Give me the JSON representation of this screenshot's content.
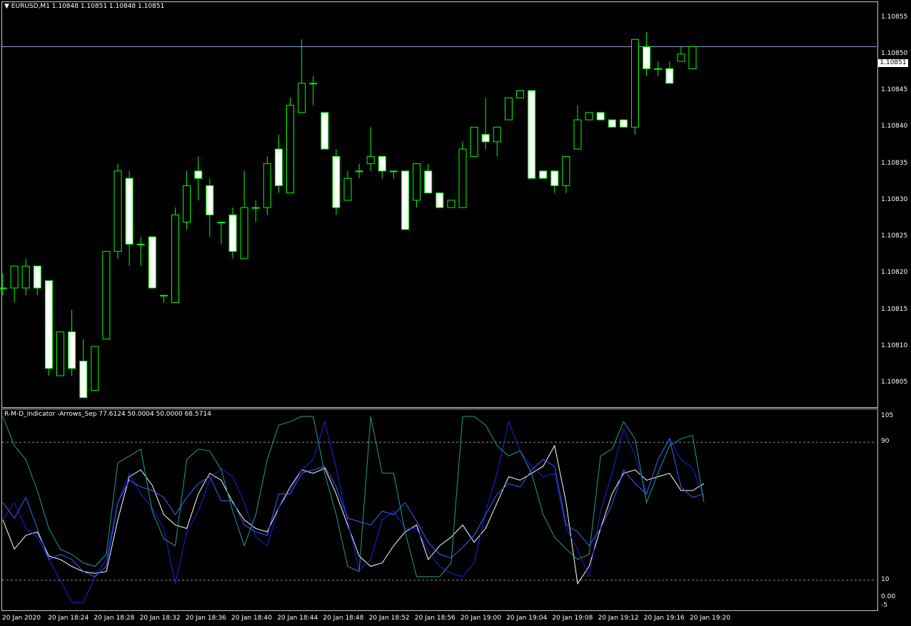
{
  "main_title": "EURUSD,M1  1.10848 1.10851 1.10848 1.10851",
  "indicator_title": "R-M-D_Indicator -Arrows_Sep 77.6124 50.0004 50.0000 68.5714",
  "current_price": "1.10851",
  "colors": {
    "bull": "#00ff00",
    "bear_fill": "#ffffff",
    "bid_line": "#8aa0c8",
    "ind_white": "#ffffff",
    "ind_blue": "#2020e0",
    "ind_royal": "#4060ff",
    "ind_teal": "#20a090",
    "level": "#909090"
  },
  "price_axis": {
    "labels": [
      "1.10855",
      "1.10850",
      "1.10845",
      "1.10840",
      "1.10835",
      "1.10830",
      "1.10825",
      "1.10820",
      "1.10815",
      "1.10810",
      "1.10805"
    ]
  },
  "ind_axis": {
    "labels": [
      "105",
      "90",
      "10",
      "0.00",
      "-5"
    ],
    "levels": [
      90,
      10
    ]
  },
  "time_axis": [
    "20 Jan 2020",
    "20 Jan 18:24",
    "20 Jan 18:28",
    "20 Jan 18:32",
    "20 Jan 18:36",
    "20 Jan 18:40",
    "20 Jan 18:44",
    "20 Jan 18:48",
    "20 Jan 18:52",
    "20 Jan 18:56",
    "20 Jan 19:00",
    "20 Jan 19:04",
    "20 Jan 19:08",
    "20 Jan 19:12",
    "20 Jan 19:16",
    "20 Jan 19:20"
  ],
  "chart_data": {
    "type": "candlestick",
    "candles": [
      {
        "o": 1.10818,
        "h": 1.1082,
        "l": 1.10817,
        "c": 1.10818
      },
      {
        "o": 1.10818,
        "h": 1.10821,
        "l": 1.10816,
        "c": 1.10821
      },
      {
        "o": 1.10818,
        "h": 1.10822,
        "l": 1.10817,
        "c": 1.10821
      },
      {
        "o": 1.10821,
        "h": 1.10821,
        "l": 1.10817,
        "c": 1.10818
      },
      {
        "o": 1.10819,
        "h": 1.10819,
        "l": 1.10806,
        "c": 1.10807
      },
      {
        "o": 1.10806,
        "h": 1.10812,
        "l": 1.10806,
        "c": 1.10812
      },
      {
        "o": 1.10812,
        "h": 1.10815,
        "l": 1.10806,
        "c": 1.10807
      },
      {
        "o": 1.10808,
        "h": 1.10811,
        "l": 1.10803,
        "c": 1.10803
      },
      {
        "o": 1.10804,
        "h": 1.1081,
        "l": 1.10804,
        "c": 1.1081
      },
      {
        "o": 1.10811,
        "h": 1.10823,
        "l": 1.10811,
        "c": 1.10823
      },
      {
        "o": 1.10823,
        "h": 1.10835,
        "l": 1.10822,
        "c": 1.10834
      },
      {
        "o": 1.10833,
        "h": 1.10834,
        "l": 1.10821,
        "c": 1.10824
      },
      {
        "o": 1.10824,
        "h": 1.10825,
        "l": 1.10821,
        "c": 1.10824
      },
      {
        "o": 1.10825,
        "h": 1.10825,
        "l": 1.10818,
        "c": 1.10818
      },
      {
        "o": 1.10817,
        "h": 1.10817,
        "l": 1.10816,
        "c": 1.10817
      },
      {
        "o": 1.10816,
        "h": 1.10829,
        "l": 1.10816,
        "c": 1.10828
      },
      {
        "o": 1.10827,
        "h": 1.10834,
        "l": 1.10826,
        "c": 1.10832
      },
      {
        "o": 1.10834,
        "h": 1.10836,
        "l": 1.1083,
        "c": 1.10833
      },
      {
        "o": 1.10832,
        "h": 1.10833,
        "l": 1.10825,
        "c": 1.10828
      },
      {
        "o": 1.10827,
        "h": 1.10827,
        "l": 1.10824,
        "c": 1.10827
      },
      {
        "o": 1.10828,
        "h": 1.10829,
        "l": 1.10822,
        "c": 1.10823
      },
      {
        "o": 1.10822,
        "h": 1.10834,
        "l": 1.10822,
        "c": 1.10829
      },
      {
        "o": 1.10829,
        "h": 1.1083,
        "l": 1.10827,
        "c": 1.10829
      },
      {
        "o": 1.10829,
        "h": 1.10836,
        "l": 1.10828,
        "c": 1.10835
      },
      {
        "o": 1.10837,
        "h": 1.10839,
        "l": 1.10831,
        "c": 1.10832
      },
      {
        "o": 1.10831,
        "h": 1.10844,
        "l": 1.10831,
        "c": 1.10843
      },
      {
        "o": 1.10842,
        "h": 1.10852,
        "l": 1.10842,
        "c": 1.10846
      },
      {
        "o": 1.10846,
        "h": 1.10847,
        "l": 1.10843,
        "c": 1.10846
      },
      {
        "o": 1.10842,
        "h": 1.10842,
        "l": 1.10837,
        "c": 1.10837
      },
      {
        "o": 1.10836,
        "h": 1.10837,
        "l": 1.10828,
        "c": 1.10829
      },
      {
        "o": 1.1083,
        "h": 1.10834,
        "l": 1.1083,
        "c": 1.10833
      },
      {
        "o": 1.10834,
        "h": 1.10835,
        "l": 1.10833,
        "c": 1.10834
      },
      {
        "o": 1.10835,
        "h": 1.1084,
        "l": 1.10834,
        "c": 1.10836
      },
      {
        "o": 1.10836,
        "h": 1.10836,
        "l": 1.10833,
        "c": 1.10834
      },
      {
        "o": 1.10834,
        "h": 1.10834,
        "l": 1.10833,
        "c": 1.10834
      },
      {
        "o": 1.10834,
        "h": 1.10834,
        "l": 1.10826,
        "c": 1.10826
      },
      {
        "o": 1.1083,
        "h": 1.10835,
        "l": 1.10829,
        "c": 1.10835
      },
      {
        "o": 1.10834,
        "h": 1.10835,
        "l": 1.10831,
        "c": 1.10831
      },
      {
        "o": 1.10831,
        "h": 1.10831,
        "l": 1.10829,
        "c": 1.10829
      },
      {
        "o": 1.10829,
        "h": 1.1083,
        "l": 1.10829,
        "c": 1.1083
      },
      {
        "o": 1.10829,
        "h": 1.10838,
        "l": 1.10829,
        "c": 1.10837
      },
      {
        "o": 1.10836,
        "h": 1.1084,
        "l": 1.10836,
        "c": 1.1084
      },
      {
        "o": 1.10839,
        "h": 1.10844,
        "l": 1.10837,
        "c": 1.10838
      },
      {
        "o": 1.10838,
        "h": 1.1084,
        "l": 1.10836,
        "c": 1.1084
      },
      {
        "o": 1.10841,
        "h": 1.10844,
        "l": 1.10841,
        "c": 1.10844
      },
      {
        "o": 1.10844,
        "h": 1.10845,
        "l": 1.10844,
        "c": 1.10845
      },
      {
        "o": 1.10845,
        "h": 1.10845,
        "l": 1.10833,
        "c": 1.10833
      },
      {
        "o": 1.10834,
        "h": 1.10834,
        "l": 1.10833,
        "c": 1.10833
      },
      {
        "o": 1.10834,
        "h": 1.10834,
        "l": 1.10831,
        "c": 1.10832
      },
      {
        "o": 1.10832,
        "h": 1.10836,
        "l": 1.10831,
        "c": 1.10836
      },
      {
        "o": 1.10837,
        "h": 1.10843,
        "l": 1.10837,
        "c": 1.10841
      },
      {
        "o": 1.10841,
        "h": 1.10842,
        "l": 1.10841,
        "c": 1.10842
      },
      {
        "o": 1.10842,
        "h": 1.10842,
        "l": 1.10841,
        "c": 1.10841
      },
      {
        "o": 1.10841,
        "h": 1.10841,
        "l": 1.1084,
        "c": 1.1084
      },
      {
        "o": 1.10841,
        "h": 1.10841,
        "l": 1.1084,
        "c": 1.1084
      },
      {
        "o": 1.1084,
        "h": 1.10852,
        "l": 1.10839,
        "c": 1.10852
      },
      {
        "o": 1.10851,
        "h": 1.10853,
        "l": 1.10847,
        "c": 1.10848
      },
      {
        "o": 1.10848,
        "h": 1.10849,
        "l": 1.10847,
        "c": 1.10848
      },
      {
        "o": 1.10848,
        "h": 1.10849,
        "l": 1.10846,
        "c": 1.10846
      },
      {
        "o": 1.10849,
        "h": 1.10851,
        "l": 1.10849,
        "c": 1.1085
      },
      {
        "o": 1.10848,
        "h": 1.10851,
        "l": 1.10848,
        "c": 1.10851
      }
    ],
    "indicator_series": [
      {
        "color_key": "ind_white",
        "values": [
          45,
          28,
          36,
          38,
          24,
          22,
          18,
          15,
          14,
          15,
          45,
          70,
          74,
          65,
          48,
          42,
          40,
          60,
          72,
          68,
          55,
          45,
          40,
          38,
          52,
          64,
          74,
          72,
          75,
          60,
          42,
          24,
          18,
          20,
          30,
          38,
          42,
          22,
          30,
          35,
          42,
          32,
          40,
          55,
          70,
          68,
          72,
          76,
          88,
          55,
          8,
          18,
          40,
          60,
          72,
          74,
          68,
          70,
          72,
          62,
          62,
          66
        ]
      },
      {
        "color_key": "ind_blue",
        "values": [
          45,
          55,
          40,
          35,
          22,
          10,
          -3,
          -3,
          12,
          22,
          55,
          72,
          60,
          52,
          40,
          8,
          38,
          50,
          68,
          75,
          70,
          55,
          35,
          30,
          52,
          62,
          74,
          80,
          102,
          75,
          44,
          16,
          22,
          45,
          50,
          40,
          40,
          27,
          18,
          14,
          12,
          20,
          50,
          72,
          102,
          85,
          76,
          70,
          72,
          40,
          28,
          12,
          50,
          72,
          98,
          82,
          60,
          80,
          92,
          80,
          75,
          58
        ]
      },
      {
        "color_key": "ind_royal",
        "values": [
          55,
          46,
          58,
          40,
          22,
          25,
          22,
          15,
          12,
          18,
          55,
          68,
          64,
          62,
          58,
          48,
          58,
          66,
          70,
          56,
          56,
          42,
          38,
          36,
          60,
          60,
          72,
          74,
          76,
          64,
          46,
          44,
          42,
          50,
          48,
          55,
          44,
          32,
          25,
          23,
          29,
          36,
          48,
          60,
          66,
          64,
          74,
          80,
          76,
          42,
          38,
          30,
          40,
          54,
          74,
          66,
          60,
          80,
          92,
          64,
          58,
          60
        ]
      },
      {
        "color_key": "ind_teal",
        "values": [
          105,
          88,
          80,
          62,
          40,
          28,
          25,
          20,
          18,
          25,
          78,
          82,
          86,
          50,
          34,
          30,
          80,
          86,
          85,
          74,
          50,
          30,
          48,
          80,
          100,
          102,
          105,
          105,
          72,
          48,
          18,
          15,
          105,
          72,
          72,
          38,
          12,
          12,
          12,
          20,
          105,
          105,
          100,
          88,
          82,
          85,
          72,
          48,
          35,
          28,
          22,
          25,
          82,
          86,
          102,
          92,
          55,
          72,
          88,
          92,
          94,
          55
        ]
      }
    ],
    "bid": 1.10851,
    "price_range": [
      1.10802,
      1.10857
    ],
    "ind_range": [
      -5,
      105
    ]
  }
}
